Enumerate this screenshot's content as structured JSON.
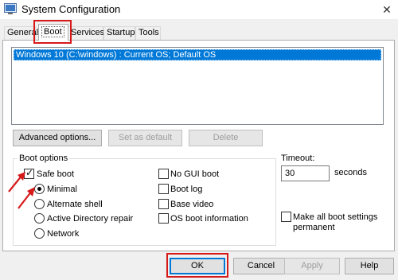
{
  "window": {
    "title": "System Configuration",
    "close_glyph": "✕"
  },
  "tabs": [
    {
      "label": "General",
      "active": false
    },
    {
      "label": "Boot",
      "active": true
    },
    {
      "label": "Services",
      "active": false
    },
    {
      "label": "Startup",
      "active": false
    },
    {
      "label": "Tools",
      "active": false
    }
  ],
  "os_list": {
    "items": [
      "Windows 10 (C:\\windows) : Current OS; Default OS"
    ],
    "selected_index": 0
  },
  "list_buttons": {
    "advanced": "Advanced options...",
    "set_default": "Set as default",
    "delete": "Delete"
  },
  "boot_options": {
    "title": "Boot options",
    "safe_boot": {
      "label": "Safe boot",
      "checked": true
    },
    "radios": [
      {
        "label": "Minimal",
        "checked": true
      },
      {
        "label": "Alternate shell",
        "checked": false
      },
      {
        "label": "Active Directory repair",
        "checked": false
      },
      {
        "label": "Network",
        "checked": false
      }
    ],
    "checks_right": [
      {
        "label": "No GUI boot",
        "checked": false
      },
      {
        "label": "Boot log",
        "checked": false
      },
      {
        "label": "Base video",
        "checked": false
      },
      {
        "label": "OS boot information",
        "checked": false
      }
    ]
  },
  "timeout": {
    "label": "Timeout:",
    "value": "30",
    "unit": "seconds"
  },
  "permanent": {
    "label_line1": "Make all boot settings",
    "label_line2": "permanent",
    "checked": false
  },
  "dialog_buttons": {
    "ok": "OK",
    "cancel": "Cancel",
    "apply": "Apply",
    "help": "Help"
  },
  "colors": {
    "highlight": "#0078d7",
    "annotation_red": "#d61a1a",
    "surface": "#f0f0f0"
  },
  "icons": {
    "app": "system-configuration-icon",
    "close": "close-icon",
    "arrows": "red-annotation-arrow-icon"
  }
}
